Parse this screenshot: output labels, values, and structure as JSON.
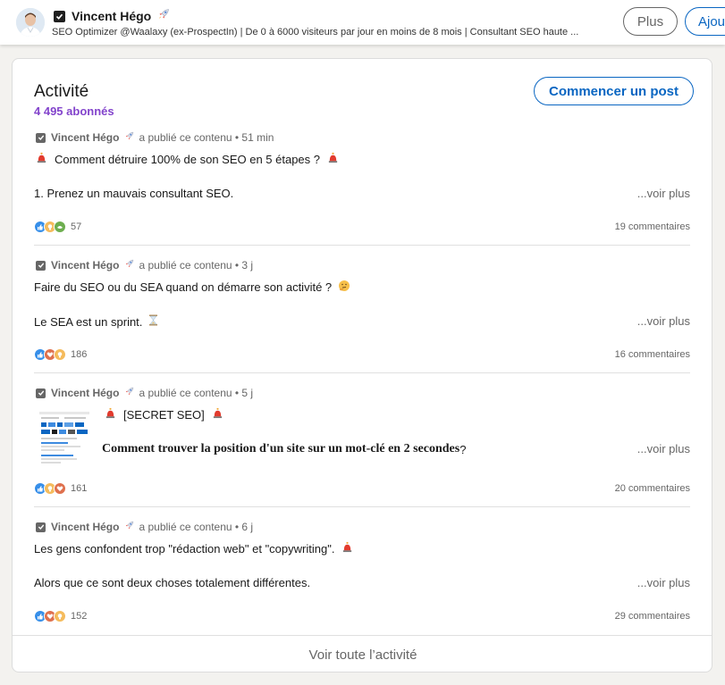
{
  "header": {
    "name": "Vincent Hégo",
    "headline": "SEO Optimizer @Waalaxy (ex-ProspectIn) | De 0 à 6000 visiteurs par jour en moins de 8 mois | Consultant SEO haute ...",
    "more_label": "Plus",
    "add_label": "Ajou"
  },
  "activity": {
    "title": "Activité",
    "followers": "4 495 abonnés",
    "start_post_label": "Commencer un post",
    "see_all_label": "Voir toute l’activité",
    "posts": [
      {
        "author": "Vincent Hégo",
        "action": "a publié ce contenu • 51 min",
        "line1": "Comment détruire 100% de son SEO en 5 étapes ?",
        "line2": "1. Prenez un mauvais consultant SEO.",
        "see_more": "...voir plus",
        "reaction_count": "57",
        "comments": "19 commentaires"
      },
      {
        "author": "Vincent Hégo",
        "action": "a publié ce contenu • 3 j",
        "line1": "Faire du SEO ou du SEA quand on démarre son activité ?",
        "line2": "Le SEA est un sprint.",
        "see_more": "...voir plus",
        "reaction_count": "186",
        "comments": "16 commentaires"
      },
      {
        "author": "Vincent Hégo",
        "action": "a publié ce contenu • 5 j",
        "line1": "[SECRET SEO]",
        "line2": "Comment trouver la position d'un site sur un mot-clé en 2 secondes",
        "line2_suffix": " ?",
        "see_more": "...voir plus",
        "reaction_count": "161",
        "comments": "20 commentaires"
      },
      {
        "author": "Vincent Hégo",
        "action": "a publié ce contenu • 6 j",
        "line1": "Les gens confondent trop \"rédaction web\" et \"copywriting\".",
        "line2": "Alors que ce sont deux choses totalement différentes.",
        "see_more": "...voir plus",
        "reaction_count": "152",
        "comments": "29 commentaires"
      }
    ]
  },
  "colors": {
    "accent": "#0a66c2",
    "followers": "#8344cc",
    "siren": "#e23b2e",
    "like": "#378fe9",
    "love": "#df704d",
    "insightful": "#f5bb5c",
    "support": "#6dae4f"
  },
  "icons": [
    "check-box-icon",
    "rocket-icon",
    "siren-icon",
    "thinking-face-icon",
    "hourglass-icon",
    "like-reaction-icon",
    "love-reaction-icon",
    "insightful-reaction-icon",
    "support-reaction-icon"
  ]
}
